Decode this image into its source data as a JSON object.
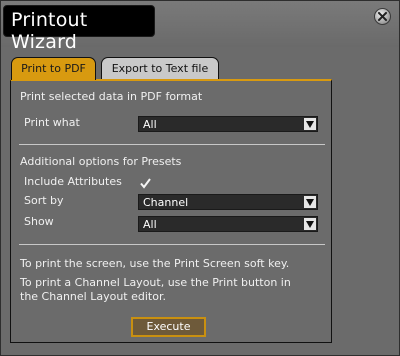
{
  "window": {
    "title": "Printout Wizard"
  },
  "tabs": [
    {
      "label": "Print to PDF",
      "active": true
    },
    {
      "label": "Export to Text file",
      "active": false
    }
  ],
  "panel": {
    "heading": "Print selected data in PDF format",
    "print_what": {
      "label": "Print what",
      "value": "All"
    },
    "presets_heading": "Additional options for Presets",
    "include_attributes": {
      "label": "Include Attributes",
      "checked": true
    },
    "sort_by": {
      "label": "Sort by",
      "value": "Channel"
    },
    "show": {
      "label": "Show",
      "value": "All"
    },
    "info_line_1": "To print the screen, use the Print Screen soft key.",
    "info_line_2a": "To print a Channel Layout, use the Print button in",
    "info_line_2b": "the Channel Layout editor.",
    "execute_label": "Execute"
  },
  "colors": {
    "accent": "#d89a10",
    "background": "#6b6b6b",
    "combo_bg": "#2a2a2a"
  },
  "icons": {
    "close": "close-icon",
    "dropdown": "chevron-down-icon",
    "check": "checkmark-icon"
  }
}
